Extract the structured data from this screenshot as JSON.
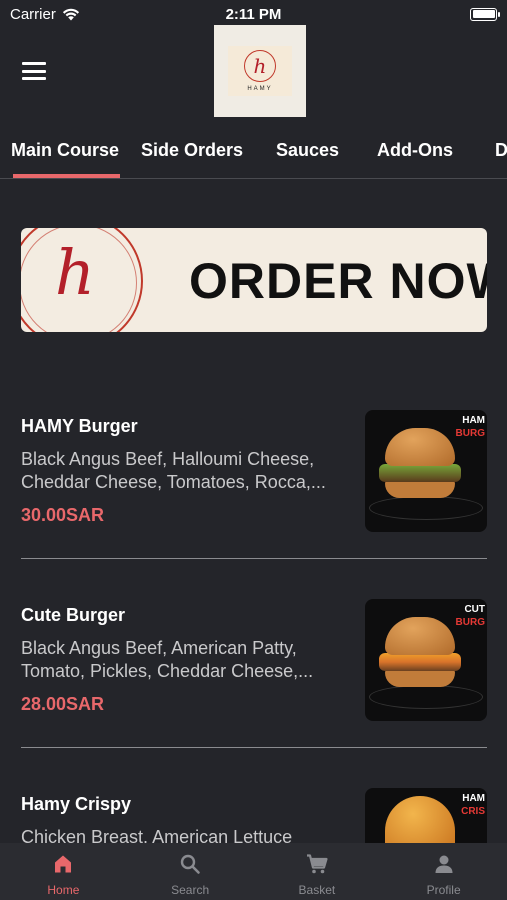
{
  "status_bar": {
    "carrier": "Carrier",
    "time": "2:11 PM"
  },
  "header": {
    "logo_letter": "h",
    "logo_text": "HAMY"
  },
  "tabs": [
    {
      "label": "Main Course",
      "active": true
    },
    {
      "label": "Side Orders",
      "active": false
    },
    {
      "label": "Sauces",
      "active": false
    },
    {
      "label": "Add-Ons",
      "active": false
    },
    {
      "label": "D",
      "active": false
    }
  ],
  "banner": {
    "logo_letter": "h",
    "text": "ORDER NOW"
  },
  "menu_items": [
    {
      "name": "HAMY Burger",
      "description": "Black Angus Beef, Halloumi Cheese, Cheddar Cheese, Tomatoes, Rocca,...",
      "price": "30.00SAR",
      "image_tag_white": "HAM",
      "image_tag_red": "BURG"
    },
    {
      "name": "Cute Burger",
      "description": "Black Angus Beef, American Patty, Tomato, Pickles, Cheddar Cheese,...",
      "price": "28.00SAR",
      "image_tag_white": "CUT",
      "image_tag_red": "BURG"
    },
    {
      "name": "Hamy Crispy",
      "description": "Chicken Breast, American Lettuce",
      "price": "",
      "image_tag_white": "HAM",
      "image_tag_red": "CRIS"
    }
  ],
  "bottom_nav": [
    {
      "label": "Home",
      "icon": "home-icon",
      "active": true
    },
    {
      "label": "Search",
      "icon": "search-icon",
      "active": false
    },
    {
      "label": "Basket",
      "icon": "cart-icon",
      "active": false
    },
    {
      "label": "Profile",
      "icon": "person-icon",
      "active": false
    }
  ],
  "colors": {
    "background": "#24252a",
    "accent": "#e8686b",
    "nav_inactive": "#8a8b90"
  }
}
